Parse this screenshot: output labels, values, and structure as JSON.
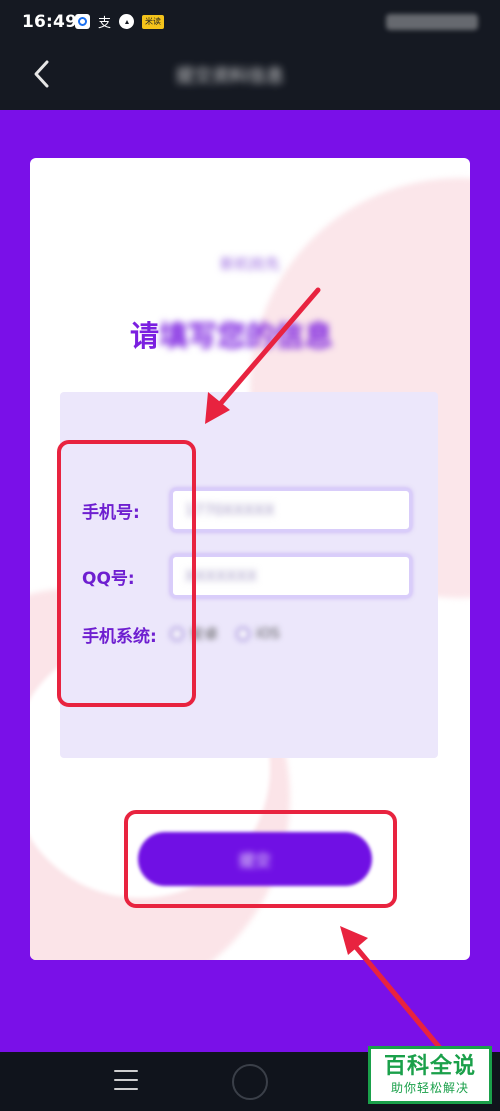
{
  "status_bar": {
    "time": "16:49",
    "icons": [
      "browser-icon",
      "alipay-icon",
      "compass-icon",
      "notification-badge-icon"
    ],
    "badge_text": "米读",
    "alipay_text": "支"
  },
  "header": {
    "back_icon": "chevron-left-icon",
    "title": "提交资料信息"
  },
  "card": {
    "subtitle": "新机抢先",
    "title_prefix": "请",
    "title_rest": "填写您的信息"
  },
  "form": {
    "phone_label": "手机号:",
    "phone_value": "1770XXXXX",
    "qq_label": "QQ号:",
    "qq_value": "XXXXXXX",
    "system_label": "手机系统:",
    "system_options": [
      "安卓",
      "iOS"
    ]
  },
  "submit_label": "提交",
  "annotations": {
    "color": "#e8233f"
  },
  "colors": {
    "accent": "#7a10e8",
    "label": "#6e1fd0",
    "watermark": "#1aa04a"
  },
  "watermark": {
    "line1": "百科全说",
    "line2": "助你轻松解决"
  }
}
